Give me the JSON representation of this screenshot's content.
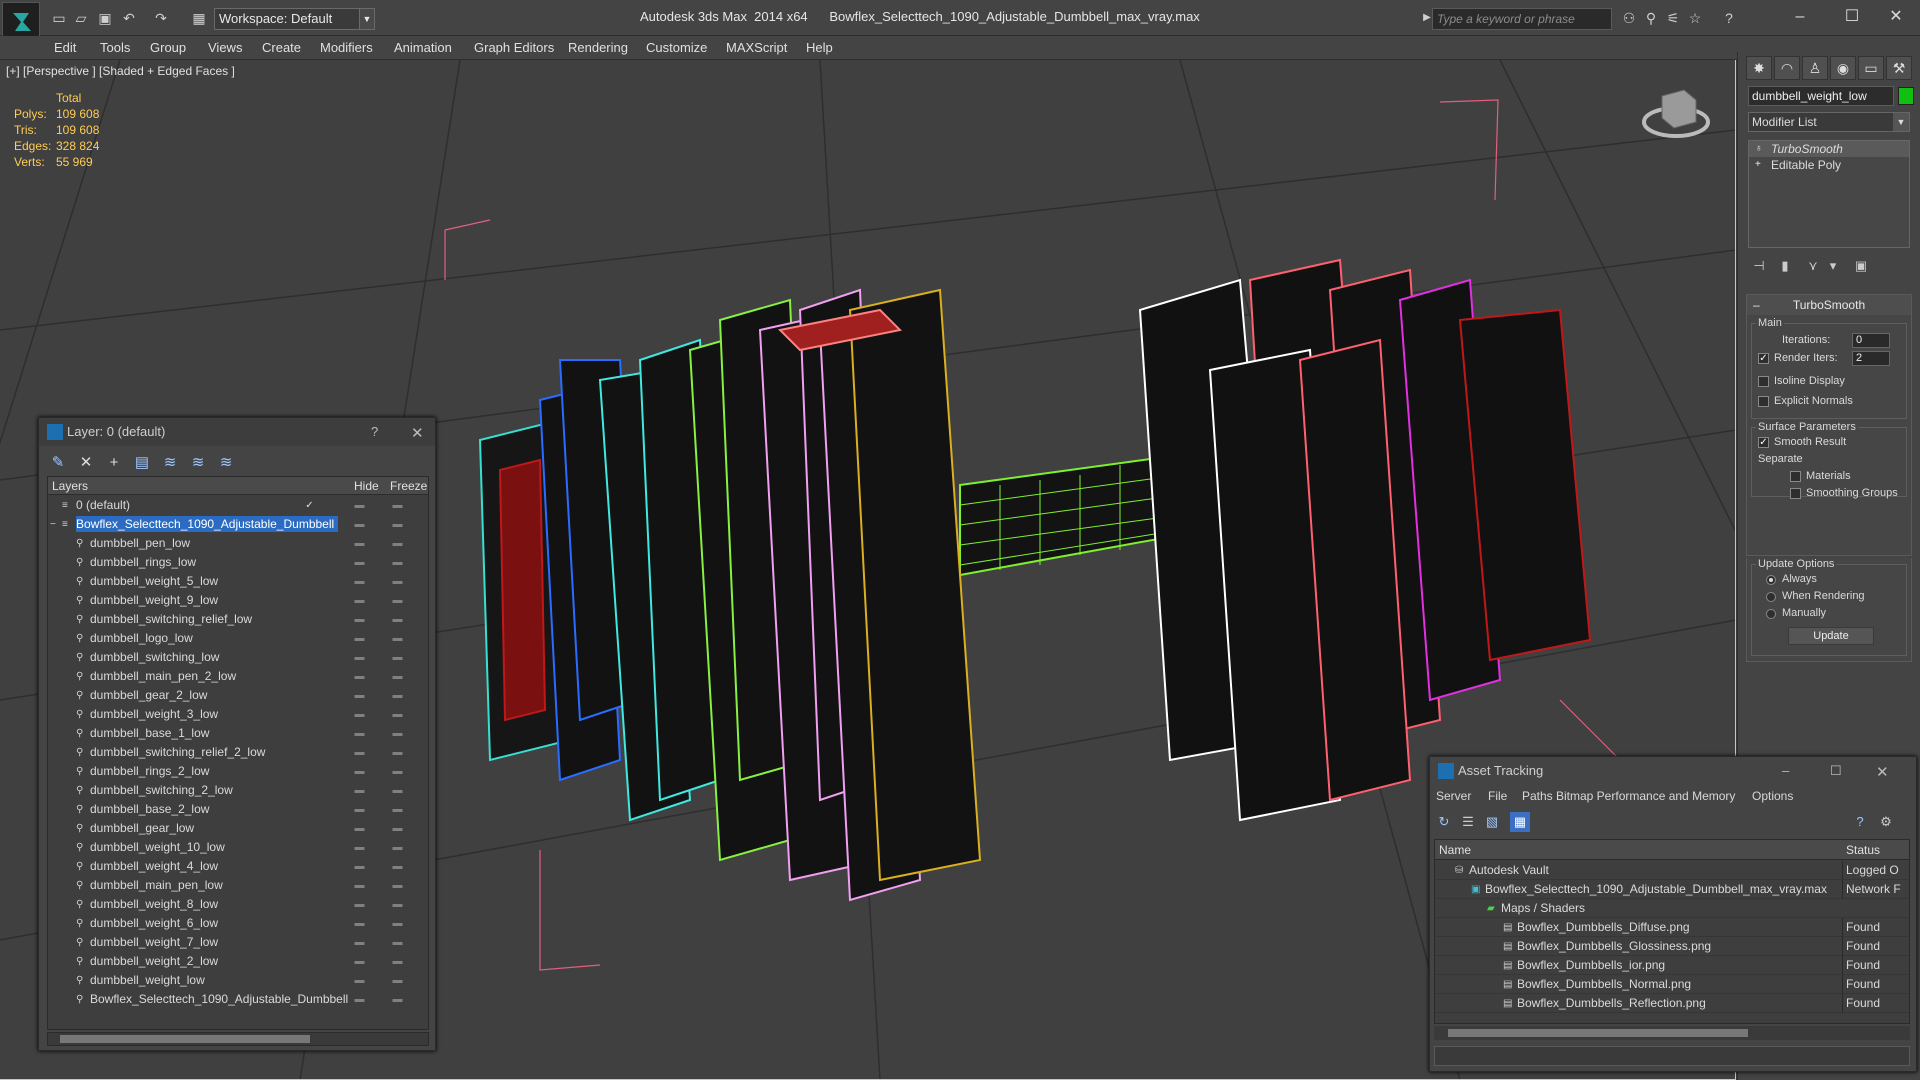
{
  "titlebar": {
    "workspace_label": "Workspace: Default",
    "app_title": "Autodesk 3ds Max  2014 x64      Bowflex_Selecttech_1090_Adjustable_Dumbbell_max_vray.max",
    "search_placeholder": "Type a keyword or phrase"
  },
  "menu": [
    "Edit",
    "Tools",
    "Group",
    "Views",
    "Create",
    "Modifiers",
    "Animation",
    "Graph Editors",
    "Rendering",
    "Customize",
    "MAXScript",
    "Help"
  ],
  "viewport": {
    "label": "[+] [Perspective ] [Shaded + Edged Faces ]",
    "stats": {
      "header": "Total",
      "rows": [
        {
          "label": "Polys:",
          "value": "109 608"
        },
        {
          "label": "Tris:",
          "value": "109 608"
        },
        {
          "label": "Edges:",
          "value": "328 824"
        },
        {
          "label": "Verts:",
          "value": "55 969"
        }
      ]
    }
  },
  "command_panel": {
    "object_name": "dumbbell_weight_low",
    "object_color": "#10c010",
    "modifier_list": "Modifier List",
    "stack": [
      {
        "label": "TurboSmooth",
        "selected": true
      },
      {
        "label": "Editable Poly",
        "selected": false
      }
    ],
    "turbosmooth": {
      "title": "TurboSmooth",
      "main_label": "Main",
      "iterations_label": "Iterations:",
      "iterations_value": "0",
      "render_iters_label": "Render Iters:",
      "render_iters_value": "2",
      "render_iters_checked": true,
      "isoline_label": "Isoline Display",
      "explicit_normals_label": "Explicit Normals",
      "surface_params_label": "Surface Parameters",
      "smooth_result_label": "Smooth Result",
      "separate_label": "Separate",
      "materials_label": "Materials",
      "smoothing_groups_label": "Smoothing Groups",
      "update_options_label": "Update Options",
      "always_label": "Always",
      "when_rendering_label": "When Rendering",
      "manually_label": "Manually",
      "update_button": "Update"
    }
  },
  "layer_window": {
    "title": "Layer: 0 (default)",
    "help": "?",
    "columns": {
      "layers": "Layers",
      "hide": "Hide",
      "freeze": "Freeze"
    },
    "rows": [
      {
        "name": "0 (default)",
        "level": 1,
        "selected": false,
        "check": "✓"
      },
      {
        "name": "Bowflex_Selecttech_1090_Adjustable_Dumbbell",
        "level": 0,
        "selected": true,
        "check": ""
      },
      {
        "name": "dumbbell_pen_low",
        "level": 2,
        "selected": false,
        "check": ""
      },
      {
        "name": "dumbbell_rings_low",
        "level": 2,
        "selected": false,
        "check": ""
      },
      {
        "name": "dumbbell_weight_5_low",
        "level": 2,
        "selected": false,
        "check": ""
      },
      {
        "name": "dumbbell_weight_9_low",
        "level": 2,
        "selected": false,
        "check": ""
      },
      {
        "name": "dumbbell_switching_relief_low",
        "level": 2,
        "selected": false,
        "check": ""
      },
      {
        "name": "dumbbell_logo_low",
        "level": 2,
        "selected": false,
        "check": ""
      },
      {
        "name": "dumbbell_switching_low",
        "level": 2,
        "selected": false,
        "check": ""
      },
      {
        "name": "dumbbell_main_pen_2_low",
        "level": 2,
        "selected": false,
        "check": ""
      },
      {
        "name": "dumbbell_gear_2_low",
        "level": 2,
        "selected": false,
        "check": ""
      },
      {
        "name": "dumbbell_weight_3_low",
        "level": 2,
        "selected": false,
        "check": ""
      },
      {
        "name": "dumbbell_base_1_low",
        "level": 2,
        "selected": false,
        "check": ""
      },
      {
        "name": "dumbbell_switching_relief_2_low",
        "level": 2,
        "selected": false,
        "check": ""
      },
      {
        "name": "dumbbell_rings_2_low",
        "level": 2,
        "selected": false,
        "check": ""
      },
      {
        "name": "dumbbell_switching_2_low",
        "level": 2,
        "selected": false,
        "check": ""
      },
      {
        "name": "dumbbell_base_2_low",
        "level": 2,
        "selected": false,
        "check": ""
      },
      {
        "name": "dumbbell_gear_low",
        "level": 2,
        "selected": false,
        "check": ""
      },
      {
        "name": "dumbbell_weight_10_low",
        "level": 2,
        "selected": false,
        "check": ""
      },
      {
        "name": "dumbbell_weight_4_low",
        "level": 2,
        "selected": false,
        "check": ""
      },
      {
        "name": "dumbbell_main_pen_low",
        "level": 2,
        "selected": false,
        "check": ""
      },
      {
        "name": "dumbbell_weight_8_low",
        "level": 2,
        "selected": false,
        "check": ""
      },
      {
        "name": "dumbbell_weight_6_low",
        "level": 2,
        "selected": false,
        "check": ""
      },
      {
        "name": "dumbbell_weight_7_low",
        "level": 2,
        "selected": false,
        "check": ""
      },
      {
        "name": "dumbbell_weight_2_low",
        "level": 2,
        "selected": false,
        "check": ""
      },
      {
        "name": "dumbbell_weight_low",
        "level": 2,
        "selected": false,
        "check": ""
      },
      {
        "name": "Bowflex_Selecttech_1090_Adjustable_Dumbbell",
        "level": 2,
        "selected": false,
        "check": ""
      }
    ]
  },
  "asset_window": {
    "title": "Asset Tracking",
    "menu": [
      "Server",
      "File",
      "Paths",
      "Bitmap Performance and Memory",
      "Options"
    ],
    "columns": {
      "name": "Name",
      "status": "Status"
    },
    "rows": [
      {
        "name": "Autodesk Vault",
        "status": "Logged O",
        "level": 1,
        "icon": "vault"
      },
      {
        "name": "Bowflex_Selecttech_1090_Adjustable_Dumbbell_max_vray.max",
        "status": "Network F",
        "level": 2,
        "icon": "max-file"
      },
      {
        "name": "Maps / Shaders",
        "status": "",
        "level": 3,
        "icon": "folder"
      },
      {
        "name": "Bowflex_Dumbbells_Diffuse.png",
        "status": "Found",
        "level": 4,
        "icon": "image"
      },
      {
        "name": "Bowflex_Dumbbells_Glossiness.png",
        "status": "Found",
        "level": 4,
        "icon": "image"
      },
      {
        "name": "Bowflex_Dumbbells_ior.png",
        "status": "Found",
        "level": 4,
        "icon": "image"
      },
      {
        "name": "Bowflex_Dumbbells_Normal.png",
        "status": "Found",
        "level": 4,
        "icon": "image"
      },
      {
        "name": "Bowflex_Dumbbells_Reflection.png",
        "status": "Found",
        "level": 4,
        "icon": "image"
      }
    ]
  },
  "model_colors": [
    "#35e0d0",
    "#2a6cff",
    "#40e8e0",
    "#88f040",
    "#f0a0f0",
    "#d8b020",
    "#c01818",
    "#ffffff",
    "#ff6070",
    "#e030e0"
  ]
}
